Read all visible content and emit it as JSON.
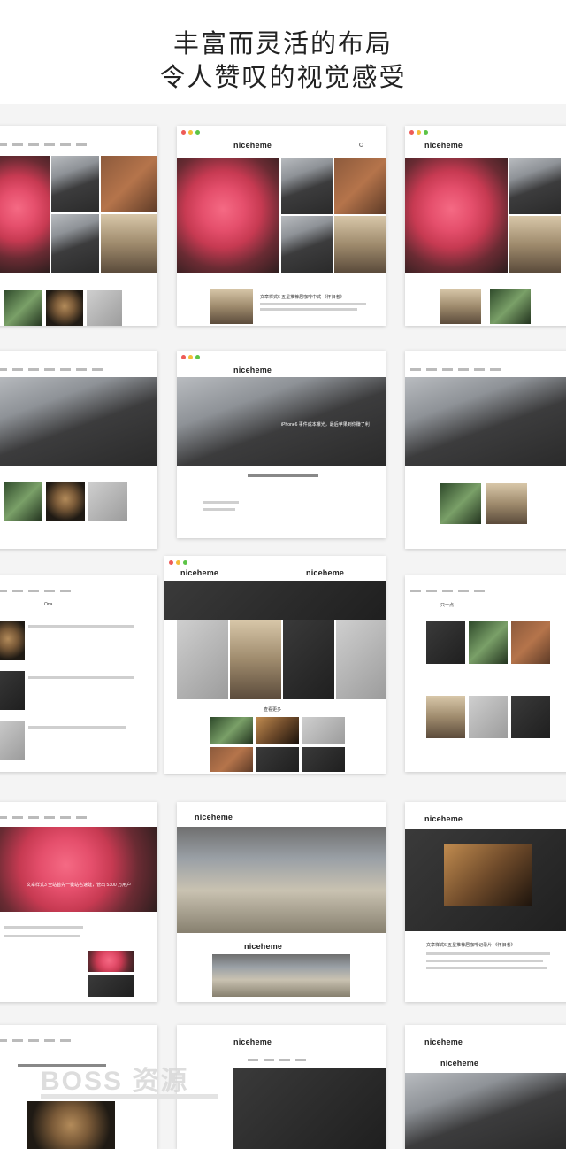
{
  "headline": {
    "line1": "丰富而灵活的布局",
    "line2": "令人赞叹的视觉感受"
  },
  "brand": "niceheme",
  "captions": {
    "hero_title": "文章样式3 全站首先一键站名速建，管出 5300 万用户",
    "iphone_note": "iPhone6 事件成本曝光，最后苹果到你赚了利",
    "feature_title": "文章样式6 五星推荐居咖啡中式 《怀旧者》",
    "cinema_title": "文章样式6 五星推荐居咖啡记录片 《怀旧者》",
    "section_one": "Ona",
    "section_two": "只一点",
    "more_label": "查看更多"
  },
  "watermark": "BOSS 资源",
  "colors": {
    "dot_red": "#ee5b57",
    "dot_yellow": "#f4bd38",
    "dot_green": "#5cc446"
  }
}
